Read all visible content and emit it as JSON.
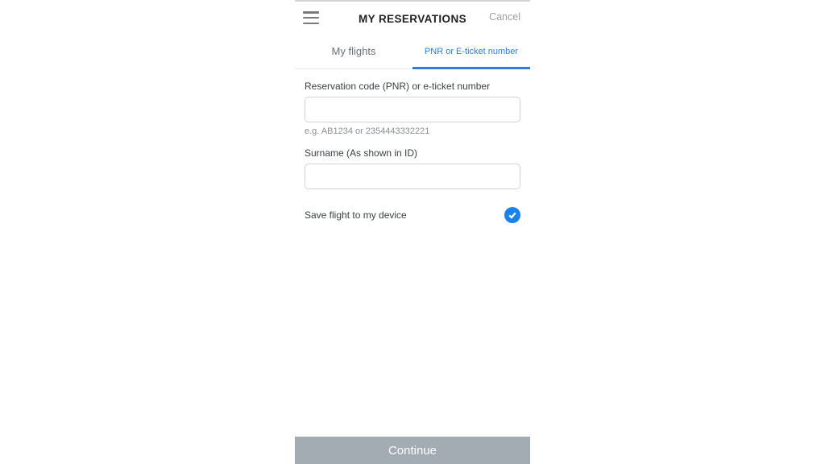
{
  "header": {
    "title": "MY RESERVATIONS",
    "cancel_label": "Cancel"
  },
  "tabs": {
    "my_flights": "My flights",
    "pnr": "PNR or E-ticket number"
  },
  "form": {
    "pnr_label": "Reservation code (PNR) or e-ticket number",
    "pnr_value": "",
    "pnr_hint": "e.g. AB1234 or 2354443332221",
    "surname_label": "Surname (As shown in ID)",
    "surname_value": ""
  },
  "save_toggle": {
    "label": "Save flight to my device",
    "checked": true
  },
  "footer": {
    "continue_label": "Continue"
  },
  "colors": {
    "accent": "#2a7de1",
    "disabled_button": "#a3abb3"
  }
}
